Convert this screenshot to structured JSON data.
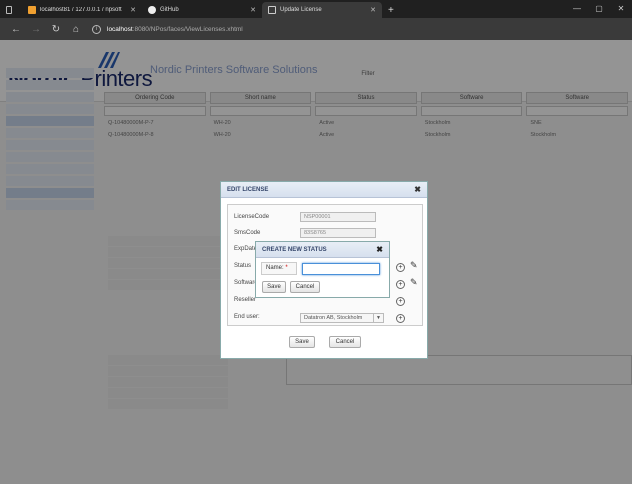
{
  "browser": {
    "tabs": [
      {
        "label": "localhost81 / 127.0.0.1 / npsoft",
        "active": false
      },
      {
        "label": "GitHub",
        "active": false
      },
      {
        "label": "Update License",
        "active": true
      }
    ],
    "url_host": "localhost",
    "url_rest": ":8080/NPos/faces/ViewLicenses.xhtml"
  },
  "header": {
    "logo_bold": "Nordic",
    "logo_plain": "Printers",
    "subtitle": "Nordic Printers Software Solutions"
  },
  "main": {
    "filter_title": "Filter",
    "columns": [
      "Ordering Code",
      "Short name",
      "Status",
      "Software",
      "Software"
    ],
    "rows": [
      [
        "Q-10480000M-P-7",
        "WH-20",
        "Active",
        "Stockholm",
        "SNE"
      ],
      [
        "Q-10480000M-P-8",
        "WH-20",
        "Active",
        "Stockholm",
        "Stockholm"
      ]
    ]
  },
  "edit_dialog": {
    "title": "EDIT LICENSE",
    "fields": {
      "license_code_label": "LicenseCode",
      "license_code_value": "NSP00001",
      "sms_code_label": "SmsCode",
      "sms_code_value": "83S8765",
      "exp_date_label": "ExpDate",
      "status_label": "Status",
      "software_label": "Software",
      "reseller_label": "Reseller",
      "end_user_label": "End user:",
      "end_user_value": "Datatron AB, Stockholm"
    },
    "save_label": "Save",
    "cancel_label": "Cancel"
  },
  "status_dialog": {
    "title": "CREATE NEW STATUS",
    "name_label": "Name:",
    "required_mark": "*",
    "name_value": "",
    "save_label": "Save",
    "cancel_label": "Cancel"
  },
  "colors": {
    "logo": "#1a2a6c",
    "dialog_title": "#34456a",
    "focus": "#4a90d9"
  }
}
